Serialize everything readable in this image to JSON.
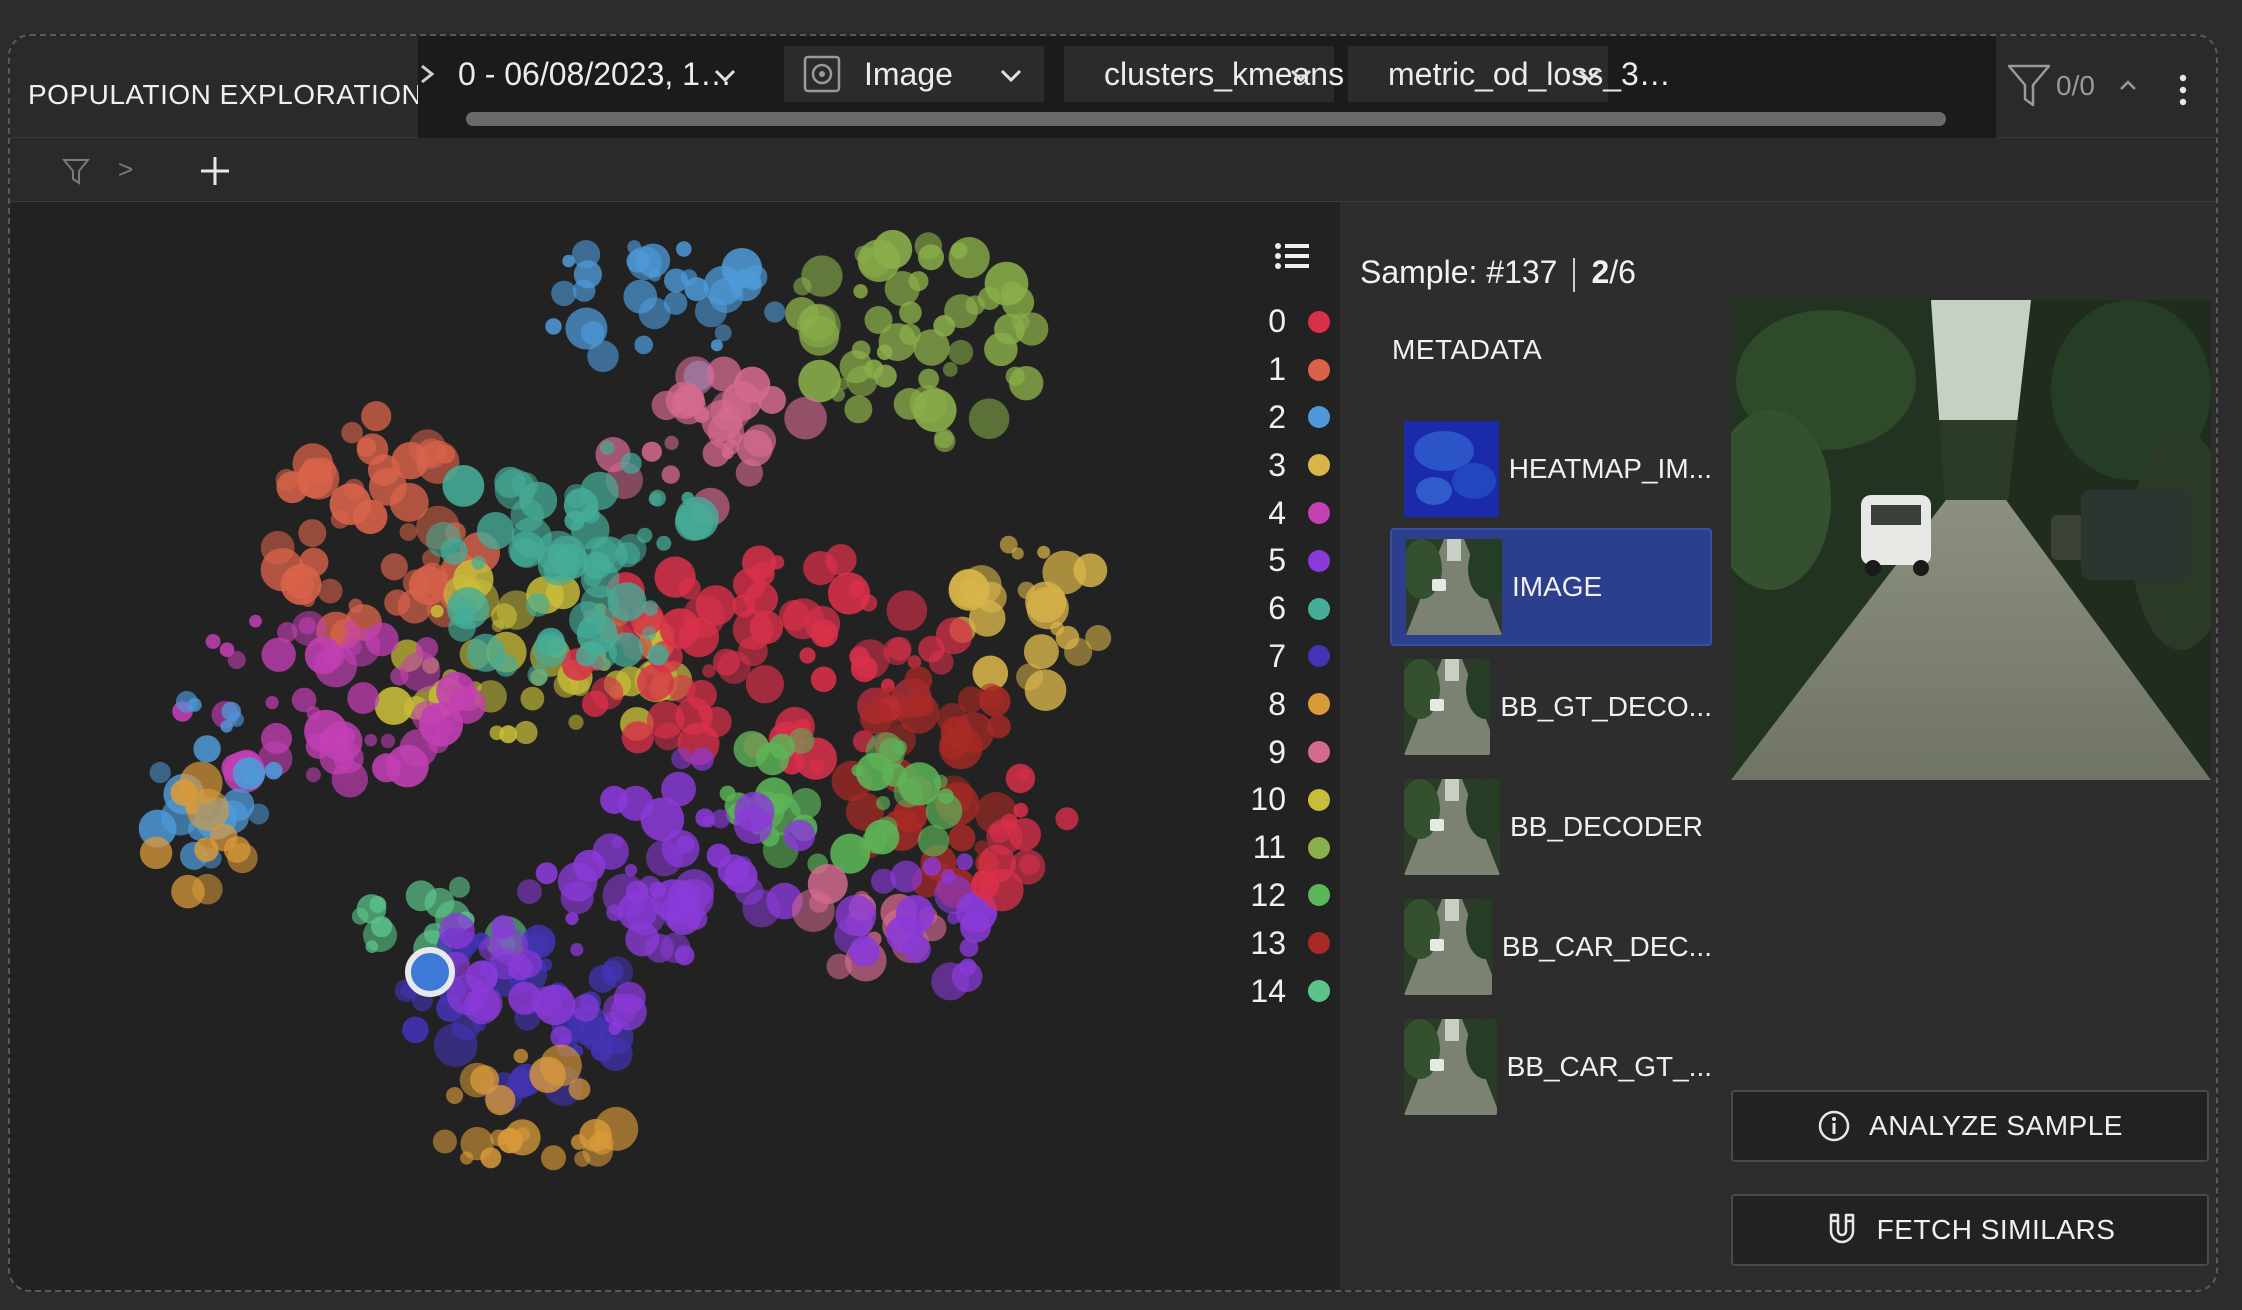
{
  "header": {
    "title": "POPULATION EXPLORATION",
    "selectors": [
      {
        "label": "0 - 06/08/2023, 1…",
        "icon": "arrow-icon"
      },
      {
        "label": "Image",
        "icon": "image-target-icon"
      },
      {
        "label": "clusters_kmeans",
        "icon": "palette-icon"
      },
      {
        "label": "metric_od_loss_3…",
        "icon": "resize-horizontal-icon"
      }
    ],
    "filter_count": "0/0"
  },
  "filterbar": {
    "breadcrumb_sep": ">"
  },
  "legend": {
    "items": [
      {
        "label": "0",
        "color": "#d9304a"
      },
      {
        "label": "1",
        "color": "#d9634a"
      },
      {
        "label": "2",
        "color": "#4e9ad8"
      },
      {
        "label": "3",
        "color": "#d8b44a"
      },
      {
        "label": "4",
        "color": "#c23fb4"
      },
      {
        "label": "5",
        "color": "#8a3ad8"
      },
      {
        "label": "6",
        "color": "#45ad98"
      },
      {
        "label": "7",
        "color": "#4234b4"
      },
      {
        "label": "8",
        "color": "#d99a3a"
      },
      {
        "label": "9",
        "color": "#d46a90"
      },
      {
        "label": "10",
        "color": "#c8bd3a"
      },
      {
        "label": "11",
        "color": "#8aae4a"
      },
      {
        "label": "12",
        "color": "#5cb558"
      },
      {
        "label": "13",
        "color": "#a82a26"
      },
      {
        "label": "14",
        "color": "#5cc48a"
      }
    ]
  },
  "sample": {
    "label": "Sample: #137",
    "page_current": "2",
    "page_total": "/6"
  },
  "metadata": {
    "title": "METADATA",
    "items": [
      {
        "label": "HEATMAP_IM...",
        "active": false,
        "kind": "heatmap"
      },
      {
        "label": "IMAGE",
        "active": true,
        "kind": "photo"
      },
      {
        "label": "BB_GT_DECO...",
        "active": false,
        "kind": "photo"
      },
      {
        "label": "BB_DECODER",
        "active": false,
        "kind": "photo"
      },
      {
        "label": "BB_CAR_DEC...",
        "active": false,
        "kind": "photo"
      },
      {
        "label": "BB_CAR_GT_...",
        "active": false,
        "kind": "photo"
      }
    ]
  },
  "actions": {
    "analyze": "ANALYZE SAMPLE",
    "fetch": "FETCH SIMILARS"
  }
}
